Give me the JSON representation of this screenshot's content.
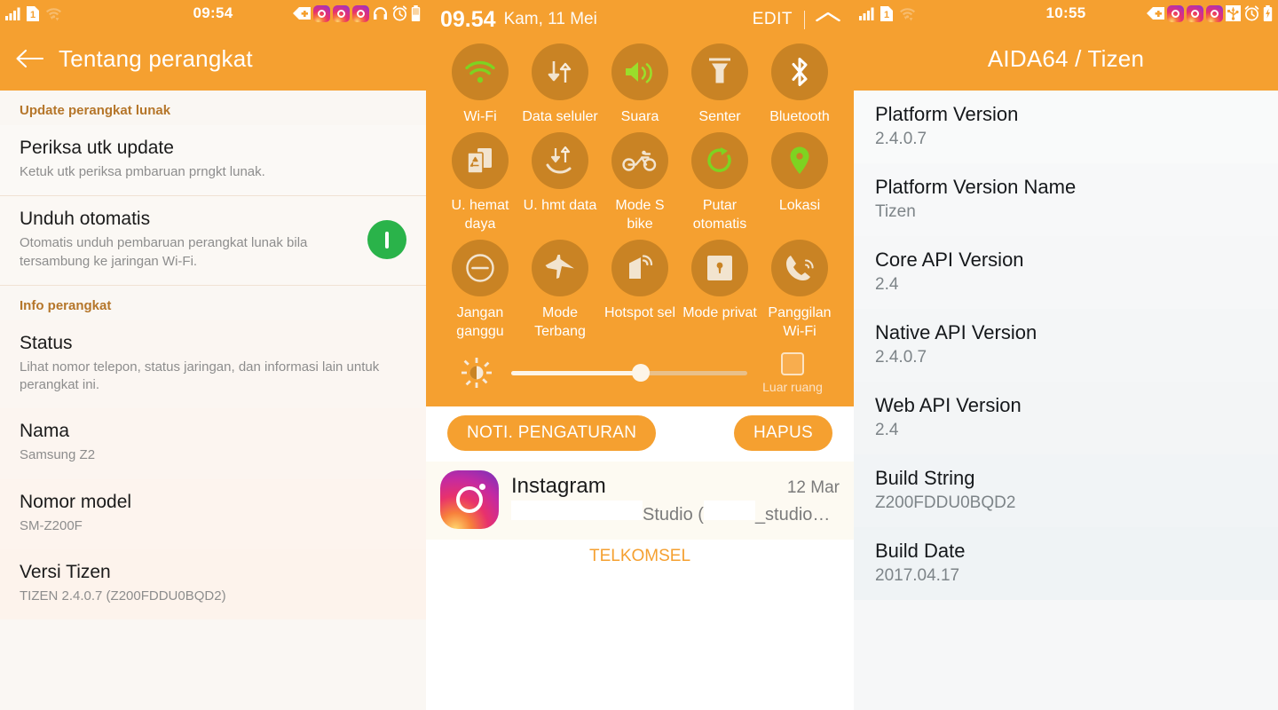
{
  "settings_panel": {
    "statusbar": {
      "clock": "09:54",
      "left_icons": [
        "signal-bars-icon",
        "sim1-icon",
        "wifi-transfer-icon"
      ],
      "right_icons": [
        "medical-tag-icon",
        "instagram-icon",
        "instagram-icon",
        "instagram-icon",
        "headphones-icon",
        "alarm-icon",
        "battery-icon"
      ]
    },
    "appbar": {
      "back_label": "←",
      "title": "Tentang perangkat"
    },
    "sections": [
      {
        "header": "Update perangkat lunak",
        "rows": [
          {
            "title": "Periksa utk update",
            "subtitle": "Ketuk utk periksa pmbaruan prngkt lunak.",
            "toggle": null
          },
          {
            "title": "Unduh otomatis",
            "subtitle": "Otomatis unduh pembaruan perangkat lunak bila tersambung ke jaringan Wi-Fi.",
            "toggle": "on"
          }
        ]
      },
      {
        "header": "Info perangkat",
        "rows": [
          {
            "title": "Status",
            "subtitle": "Lihat nomor telepon, status jaringan, dan informasi lain untuk perangkat ini.",
            "toggle": null
          },
          {
            "title": "Nama",
            "subtitle": "Samsung Z2",
            "toggle": null
          },
          {
            "title": "Nomor model",
            "subtitle": "SM-Z200F",
            "toggle": null
          },
          {
            "title": "Versi Tizen",
            "subtitle": "TIZEN 2.4.0.7 (Z200FDDU0BQD2)",
            "toggle": null
          }
        ]
      }
    ]
  },
  "quick_settings_panel": {
    "header": {
      "time": "09.54",
      "date": "Kam, 11 Mei",
      "edit_label": "EDIT",
      "collapse_icon": "chevron-up-icon"
    },
    "tiles": [
      {
        "label": "Wi-Fi",
        "icon": "wifi-icon",
        "state": "on"
      },
      {
        "label": "Data seluler",
        "icon": "data-transfer-icon",
        "state": "off"
      },
      {
        "label": "Suara",
        "icon": "speaker-icon",
        "state": "on"
      },
      {
        "label": "Senter",
        "icon": "flashlight-icon",
        "state": "off"
      },
      {
        "label": "Bluetooth",
        "icon": "bluetooth-icon",
        "state": "off"
      },
      {
        "label": "U. hemat daya",
        "icon": "power-saving-icon",
        "state": "off"
      },
      {
        "label": "U. hmt data",
        "icon": "data-saving-icon",
        "state": "off"
      },
      {
        "label": "Mode S bike",
        "icon": "motorbike-icon",
        "state": "off"
      },
      {
        "label": "Putar otomatis",
        "icon": "rotate-icon",
        "state": "on"
      },
      {
        "label": "Lokasi",
        "icon": "location-pin-icon",
        "state": "on"
      },
      {
        "label": "Jangan ganggu",
        "icon": "do-not-disturb-icon",
        "state": "off"
      },
      {
        "label": "Mode Terbang",
        "icon": "airplane-icon",
        "state": "off"
      },
      {
        "label": "Hotspot sel",
        "icon": "hotspot-icon",
        "state": "off"
      },
      {
        "label": "Mode privat",
        "icon": "lock-icon",
        "state": "off"
      },
      {
        "label": "Panggilan Wi-Fi",
        "icon": "wifi-calling-icon",
        "state": "off"
      }
    ],
    "brightness": {
      "icon": "brightness-icon",
      "value_percent": 55,
      "auto_label": "Luar ruang",
      "auto_checked": false
    },
    "buttons": {
      "settings_label": "NOTI. PENGATURAN",
      "clear_label": "HAPUS"
    },
    "notification": {
      "icon": "instagram-icon",
      "app": "Instagram",
      "time": "12 Mar",
      "body_prefix": "",
      "body_middle": "Studio (",
      "body_suffix": "_studio…"
    },
    "carrier": "TELKOMSEL"
  },
  "aida_panel": {
    "statusbar": {
      "clock": "10:55",
      "left_icons": [
        "signal-bars-icon",
        "sim1-icon",
        "wifi-transfer-icon"
      ],
      "right_icons": [
        "medical-tag-icon",
        "instagram-icon",
        "instagram-icon",
        "instagram-icon",
        "usb-icon",
        "alarm-icon",
        "battery-charging-icon"
      ]
    },
    "appbar": {
      "title": "AIDA64 / Tizen"
    },
    "rows": [
      {
        "key": "Platform Version",
        "value": "2.4.0.7"
      },
      {
        "key": "Platform Version Name",
        "value": "Tizen"
      },
      {
        "key": "Core API Version",
        "value": "2.4"
      },
      {
        "key": "Native API Version",
        "value": "2.4.0.7"
      },
      {
        "key": "Web API Version",
        "value": "2.4"
      },
      {
        "key": "Build String",
        "value": "Z200FDDU0BQD2"
      },
      {
        "key": "Build Date",
        "value": "2017.04.17"
      }
    ]
  },
  "colors": {
    "accent_orange": "#f5a030",
    "tile_circle": "#c98324",
    "toggle_green": "#2ab34a",
    "icon_green": "#7ed321",
    "section_header": "#b5762a"
  }
}
